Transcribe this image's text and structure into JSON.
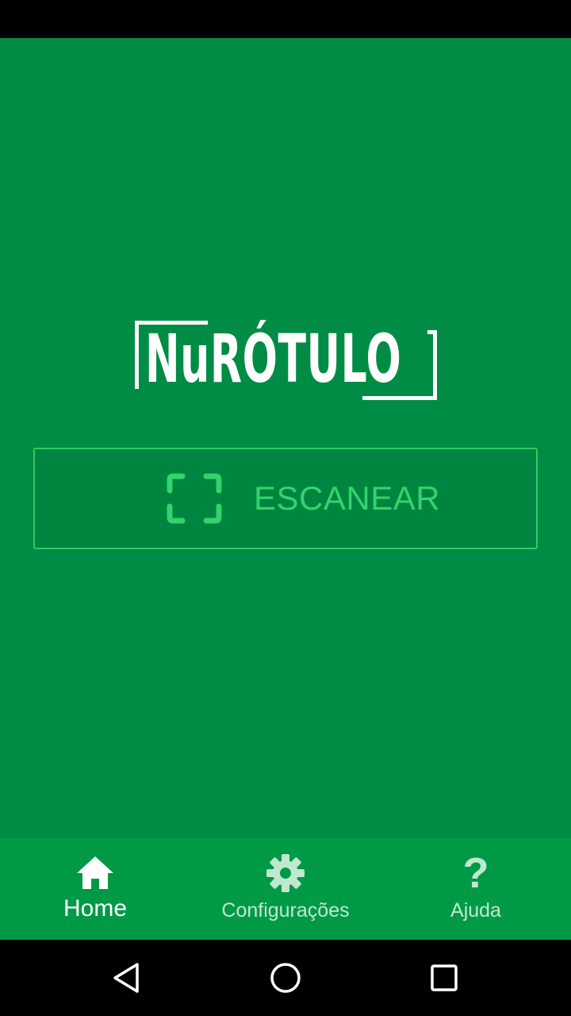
{
  "app": {
    "logo_text": "NuRÓTULO"
  },
  "scan_button": {
    "label": "ESCANEAR",
    "icon": "scan-frame-icon"
  },
  "bottom_nav": {
    "items": [
      {
        "label": "Home",
        "icon": "home-icon",
        "active": true
      },
      {
        "label": "Configurações",
        "icon": "gear-icon",
        "active": false
      },
      {
        "label": "Ajuda",
        "icon": "help-icon",
        "active": false
      }
    ],
    "help_glyph": "?"
  },
  "system_nav": {
    "back": "back-icon",
    "home": "home-circle-icon",
    "recents": "recents-icon"
  },
  "colors": {
    "background": "#008c45",
    "bottom_nav_background": "#009a47",
    "accent": "#33d36d",
    "text_primary": "#ffffff",
    "text_inactive": "#bfe8cf"
  }
}
